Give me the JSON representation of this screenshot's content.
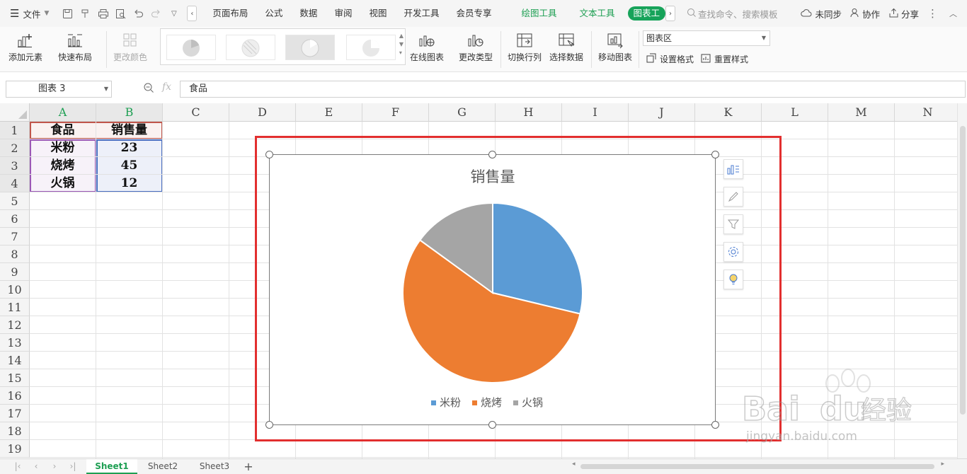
{
  "menubar": {
    "file_label": "文件",
    "tabs": [
      "页面布局",
      "公式",
      "数据",
      "审阅",
      "视图",
      "开发工具",
      "会员专享"
    ],
    "context_tabs": [
      "绘图工具",
      "文本工具"
    ],
    "active_tab": "图表工",
    "search_placeholder": "查找命令、搜索模板",
    "sync_label": "未同步",
    "collab_label": "协作",
    "share_label": "分享"
  },
  "ribbon": {
    "add_element": "添加元素",
    "quick_layout": "快速布局",
    "change_color": "更改颜色",
    "online_chart": "在线图表",
    "change_type": "更改类型",
    "switch_rowcol": "切换行列",
    "select_data": "选择数据",
    "move_chart": "移动图表",
    "chart_area_select": "图表区",
    "set_format": "设置格式",
    "reset_style": "重置样式"
  },
  "formula_bar": {
    "name_box": "图表 3",
    "fx_label": "fx",
    "content": "食品"
  },
  "sheet": {
    "columns": [
      "A",
      "B",
      "C",
      "D",
      "E",
      "F",
      "G",
      "H",
      "I",
      "J",
      "K",
      "L",
      "M",
      "N"
    ],
    "rows": [
      "1",
      "2",
      "3",
      "4",
      "5",
      "6",
      "7",
      "8",
      "9",
      "10",
      "11",
      "12",
      "13",
      "14",
      "15",
      "16",
      "17",
      "18",
      "19"
    ],
    "cells": {
      "A1": "食品",
      "B1": "销售量",
      "A2": "米粉",
      "B2": "23",
      "A3": "烧烤",
      "B3": "45",
      "A4": "火锅",
      "B4": "12"
    }
  },
  "chart_data": {
    "type": "pie",
    "title": "销售量",
    "categories": [
      "米粉",
      "烧烤",
      "火锅"
    ],
    "values": [
      23,
      45,
      12
    ],
    "colors": [
      "#5b9bd5",
      "#ed7d31",
      "#a5a5a5"
    ],
    "legend": "bottom"
  },
  "chart_tools": [
    "chart-elements-icon",
    "chart-style-icon",
    "chart-filter-icon",
    "chart-settings-icon",
    "chart-tips-icon"
  ],
  "sheet_tabs": [
    "Sheet1",
    "Sheet2",
    "Sheet3"
  ],
  "active_sheet": "Sheet1",
  "add_sheet_label": "+",
  "watermark": {
    "brand": "Bai",
    "brand_tail": "du",
    "cn": "经验",
    "url": "jingyan.baidu.com"
  }
}
